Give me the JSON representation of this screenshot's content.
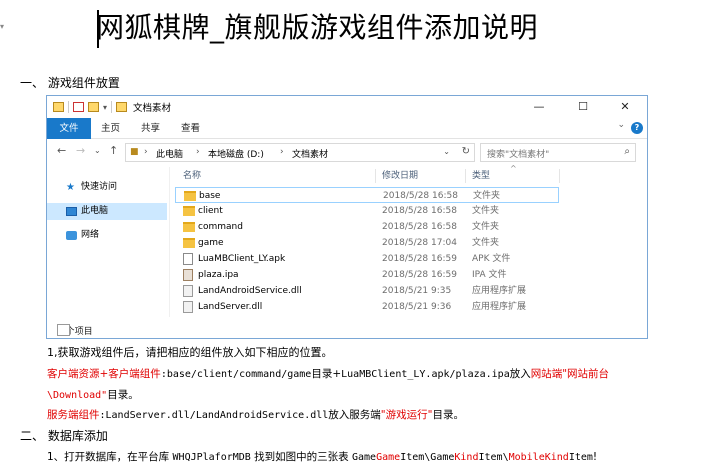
{
  "document": {
    "title": "网狐棋牌_旗舰版游戏组件添加说明",
    "section1": "一、 游戏组件放置",
    "step1": "1,获取游戏组件后，请把相应的组件放入如下相应的位置。",
    "client_label": "客户端资源+客户端组件",
    "client_path": ":base/client/command/game",
    "client_mid": "目录+",
    "client_files": "LuaMBClient_LY.apk/plaza.ipa",
    "client_put": "放入",
    "client_target": "网站端\"网站前台",
    "client_target2": "\\Download\"",
    "client_end": "目录。",
    "server_label": "服务端组件",
    "server_files": ":LandServer.dll/LandAndroidService.dll",
    "server_put": "放入服务端",
    "server_target": "\"游戏运行\"",
    "server_end": "目录。",
    "section2": "二、 数据库添加",
    "db_step_a": "1、打开数据库，在平台库 ",
    "db_name": "WHQJPlaforMDB",
    "db_step_b": " 找到如图中的三张表 ",
    "t_game": "Game",
    "t_game_hl": "Game",
    "t_item": "Item\\",
    "t_kind": "Game",
    "t_kind_hl": "Kind",
    "t_item2": "Item\\",
    "t_mobile": "MobileKind",
    "t_item3": "Item",
    "db_end": "!"
  },
  "explorer": {
    "window_title": "文档素材",
    "ribbon_tabs": [
      "文件",
      "主页",
      "共享",
      "查看"
    ],
    "breadcrumb": [
      "此电脑",
      "本地磁盘 (D:)",
      "文档素材"
    ],
    "search_placeholder": "搜索\"文档素材\"",
    "sidebar": [
      "快速访问",
      "此电脑",
      "网络"
    ],
    "columns": [
      "名称",
      "修改日期",
      "类型"
    ],
    "files": [
      {
        "name": "base",
        "date": "2018/5/28 16:58",
        "type": "文件夹",
        "icon": "folder-icon"
      },
      {
        "name": "client",
        "date": "2018/5/28 16:58",
        "type": "文件夹",
        "icon": "folder-icon"
      },
      {
        "name": "command",
        "date": "2018/5/28 16:58",
        "type": "文件夹",
        "icon": "folder-icon"
      },
      {
        "name": "game",
        "date": "2018/5/28 17:04",
        "type": "文件夹",
        "icon": "folder-icon"
      },
      {
        "name": "LuaMBClient_LY.apk",
        "date": "2018/5/28 16:59",
        "type": "APK 文件",
        "icon": "apk-file-icon"
      },
      {
        "name": "plaza.ipa",
        "date": "2018/5/28 16:59",
        "type": "IPA 文件",
        "icon": "ipa-file-icon"
      },
      {
        "name": "LandAndroidService.dll",
        "date": "2018/5/21 9:35",
        "type": "应用程序扩展",
        "icon": "dll-file-icon"
      },
      {
        "name": "LandServer.dll",
        "date": "2018/5/21 9:36",
        "type": "应用程序扩展",
        "icon": "dll-file-icon"
      }
    ],
    "status": "8 个项目"
  },
  "colors": {
    "accent": "#1979ca",
    "red_text": "#e00000",
    "selection": "#cce8ff"
  }
}
